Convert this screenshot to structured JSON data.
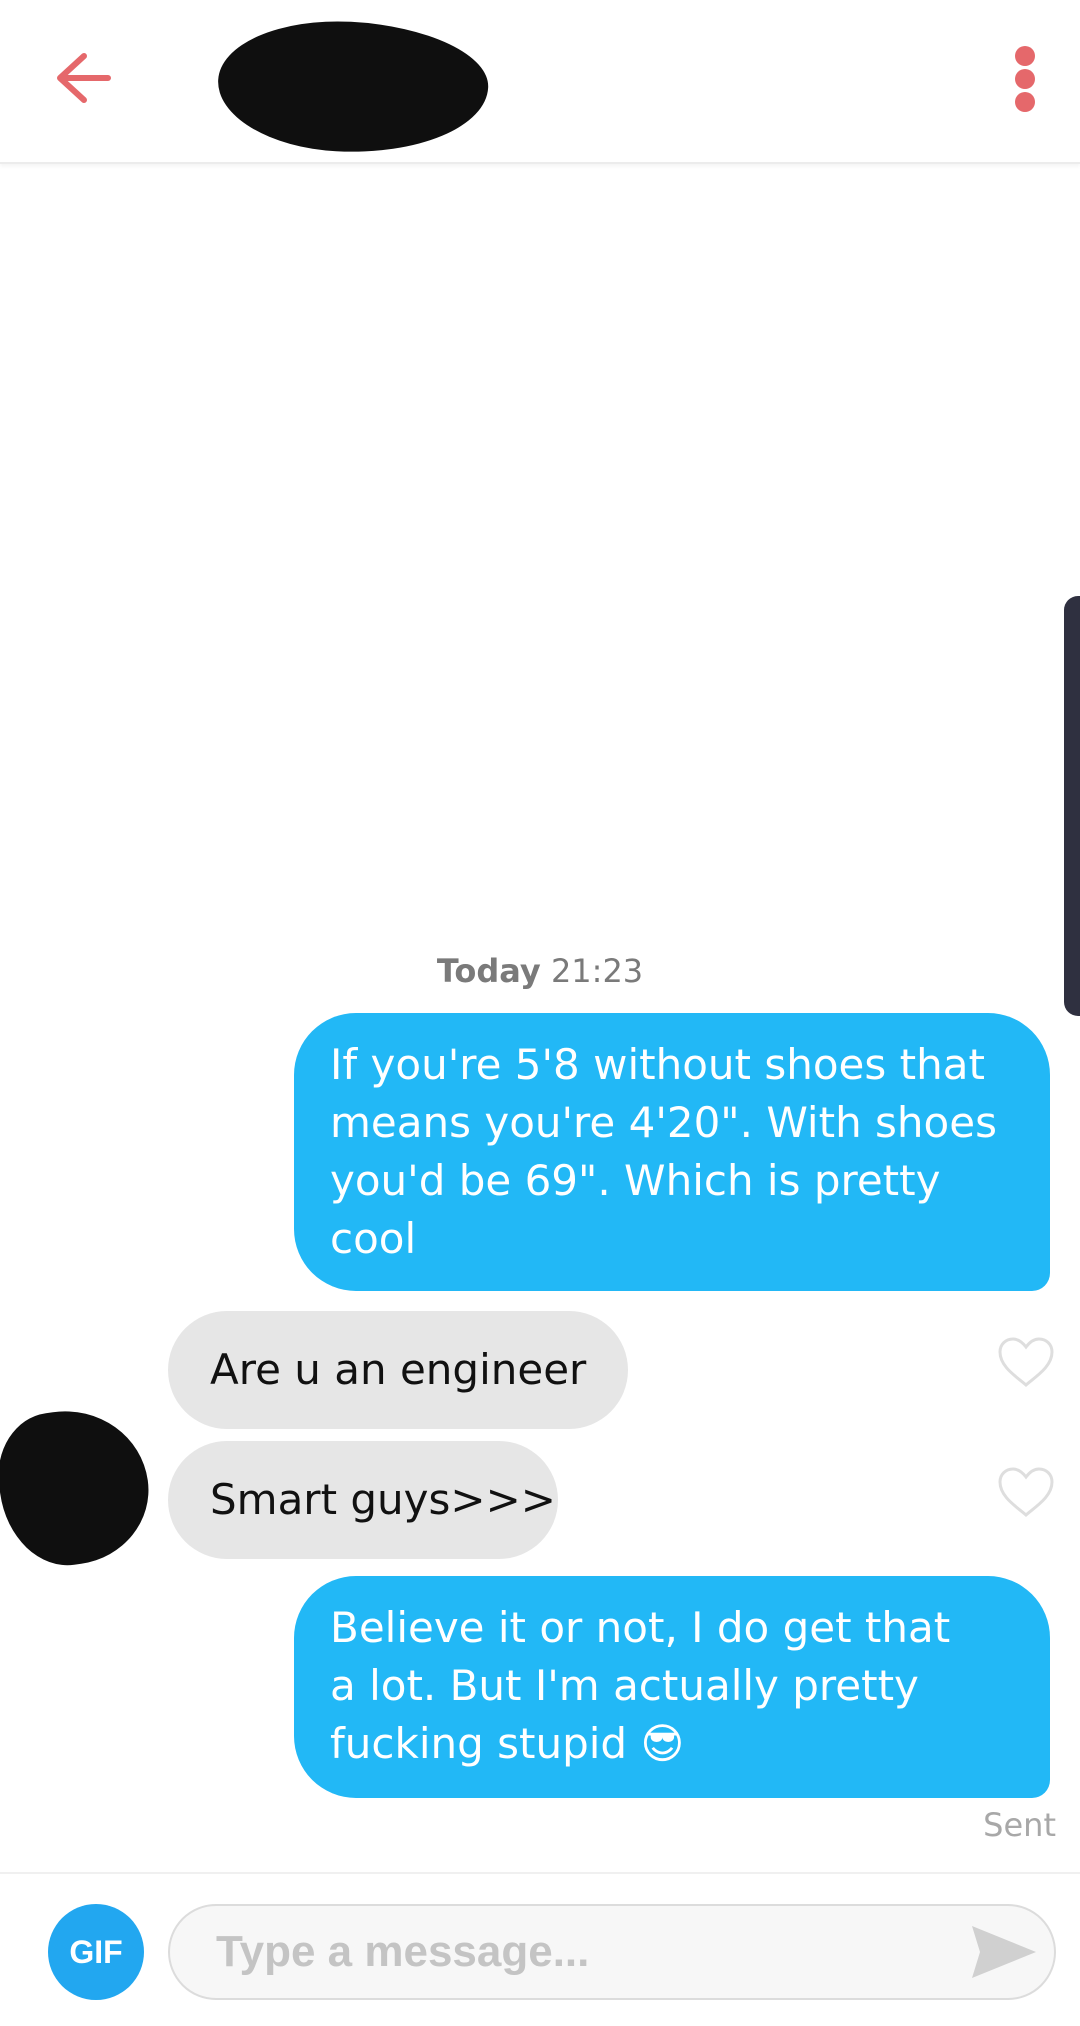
{
  "header": {
    "back_icon": "arrow-left-icon",
    "menu_icon": "more-vertical-icon",
    "accent_color": "#e5686b"
  },
  "conversation": {
    "timestamp": {
      "day": "Today",
      "time": "21:23"
    },
    "messages": [
      {
        "direction": "outgoing",
        "lines": [
          "If you're 5'8 without shoes that",
          "means you're 4'20\". With shoes",
          "you'd be 69\". Which is pretty",
          "cool"
        ]
      },
      {
        "direction": "incoming",
        "text": "Are u an engineer"
      },
      {
        "direction": "incoming",
        "text": "Smart guys>>>"
      },
      {
        "direction": "outgoing",
        "lines": [
          "Believe it or not, I do get that",
          "a lot. But I'm actually pretty",
          "fucking stupid"
        ],
        "emoji": "😎"
      }
    ],
    "sent_label": "Sent",
    "outgoing_color": "#22b8f6",
    "incoming_color": "#e6e6e6"
  },
  "composer": {
    "gif_label": "GIF",
    "placeholder": "Type a message...",
    "send_icon": "send-icon"
  }
}
